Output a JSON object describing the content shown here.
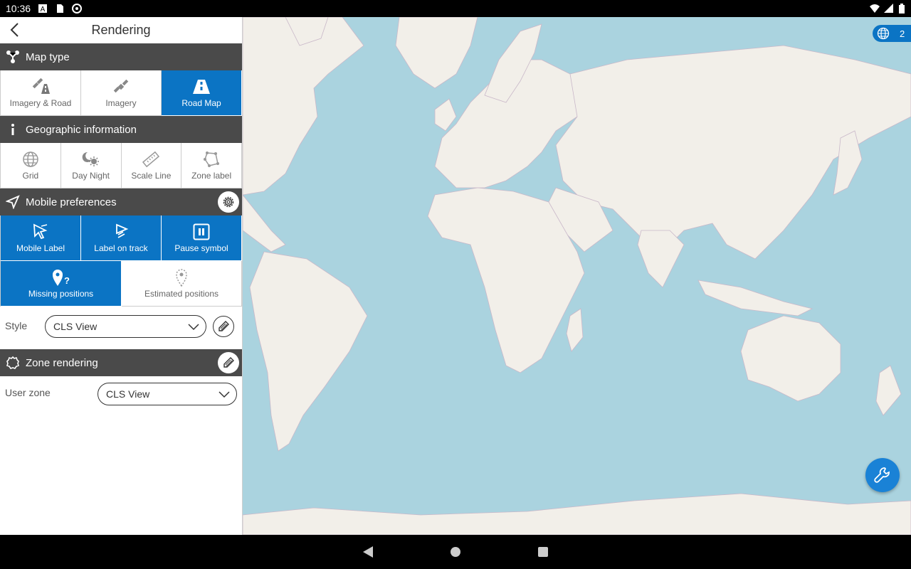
{
  "status": {
    "time": "10:36"
  },
  "header": {
    "title": "Rendering"
  },
  "map_type": {
    "title": "Map type",
    "options": [
      {
        "label": "Imagery & Road",
        "icon": "satellite-road-icon",
        "active": false
      },
      {
        "label": "Imagery",
        "icon": "satellite-icon",
        "active": false
      },
      {
        "label": "Road Map",
        "icon": "road-icon",
        "active": true
      }
    ]
  },
  "geo_info": {
    "title": "Geographic information",
    "options": [
      {
        "label": "Grid",
        "icon": "globe-grid-icon"
      },
      {
        "label": "Day Night",
        "icon": "day-night-icon"
      },
      {
        "label": "Scale Line",
        "icon": "ruler-icon"
      },
      {
        "label": "Zone label",
        "icon": "polygon-icon"
      }
    ]
  },
  "mobile_prefs": {
    "title": "Mobile preferences",
    "options": [
      {
        "label": "Mobile Label",
        "icon": "cursor-label-icon",
        "active": true
      },
      {
        "label": "Label on track",
        "icon": "track-label-icon",
        "active": true
      },
      {
        "label": "Pause symbol",
        "icon": "pause-icon",
        "active": true
      },
      {
        "label": "Missing positions",
        "icon": "pin-question-icon",
        "active": true
      },
      {
        "label": "Estimated positions",
        "icon": "pin-dotted-icon",
        "active": false
      }
    ],
    "style_label": "Style",
    "style_value": "CLS View"
  },
  "zone_rendering": {
    "title": "Zone rendering",
    "user_zone_label": "User zone",
    "user_zone_value": "CLS View"
  },
  "map": {
    "badge_count": "2"
  },
  "colors": {
    "accent": "#0b74c4",
    "section_bar": "#4a4a4a",
    "ocean": "#aad3df",
    "land": "#f2efe9"
  }
}
